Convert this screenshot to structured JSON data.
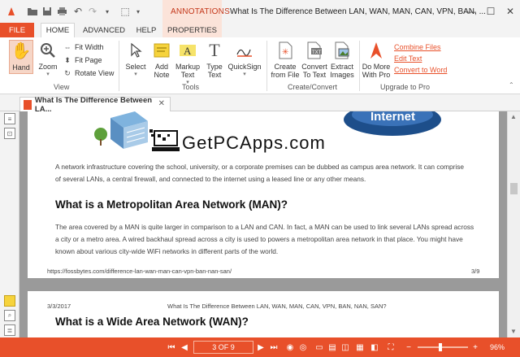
{
  "titlebar": {
    "context_tab_label": "ANNOTATIONS",
    "document_title": "What Is The Difference Between LAN, WAN, MAN, CAN, VPN, BAN, ...",
    "minimize": "—",
    "maximize": "☐",
    "close": "✕"
  },
  "tabs": {
    "file": "FILE",
    "home": "HOME",
    "advanced": "ADVANCED",
    "help": "HELP",
    "properties": "PROPERTIES"
  },
  "ribbon": {
    "view": {
      "hand": "Hand",
      "zoom": "Zoom",
      "fit_width": "Fit Width",
      "fit_page": "Fit Page",
      "rotate_view": "Rotate View",
      "group": "View"
    },
    "tools": {
      "select": "Select",
      "add_note": "Add Note",
      "markup_text": "Markup Text",
      "type_text": "Type Text",
      "quicksign": "QuickSign",
      "group": "Tools"
    },
    "create": {
      "create_from_file": "Create from File",
      "convert_to_text": "Convert To Text",
      "extract_images": "Extract Images",
      "group": "Create/Convert"
    },
    "upgrade": {
      "do_more": "Do More With Pro",
      "combine_files": "Combine Files",
      "edit_text": "Edit Text",
      "convert_to_word": "Convert to Word",
      "group": "Upgrade to Pro"
    }
  },
  "doc_tab": {
    "title": "What Is The Difference Between LA...",
    "close": "✕"
  },
  "page1": {
    "watermark": "GetPCApps.com",
    "internet_label": "Internet",
    "para1_l1": "A network infrastructure covering the school, university, or a corporate premises can be dubbed as campus area network. It can comprise",
    "para1_l2": "of several LANs, a central firewall, and connected to the internet using a leased line or any other means.",
    "heading": "What is a Metropolitan Area Network (MAN)?",
    "para2_l1": "The area covered by a MAN is quite larger in comparison to a LAN and CAN. In fact, a MAN can be used to link several LANs spread across",
    "para2_l2": "a city or a metro area. A wired backhaul spread across a city is used to powers a metropolitan area network in that place. You might have",
    "para2_l3": "known about various city-wide WiFi networks in different parts of the world.",
    "footer_url": "https://fossbytes.com/difference-lan-wan-man-can-vpn-ban-nan-san/",
    "footer_page": "3/9"
  },
  "page2": {
    "date": "3/3/2017",
    "header": "What Is The Difference Between LAN, WAN, MAN, CAN, VPN, BAN, NAN, SAN?",
    "heading": "What is a Wide Area Network (WAN)?"
  },
  "status": {
    "page_indicator": "3 OF 9",
    "zoom": "96%",
    "minus": "−",
    "plus": "+"
  },
  "colors": {
    "accent": "#e8502a",
    "context_tab_bg": "#fbe3d9",
    "hand_active_bg": "#f6d6c7"
  }
}
